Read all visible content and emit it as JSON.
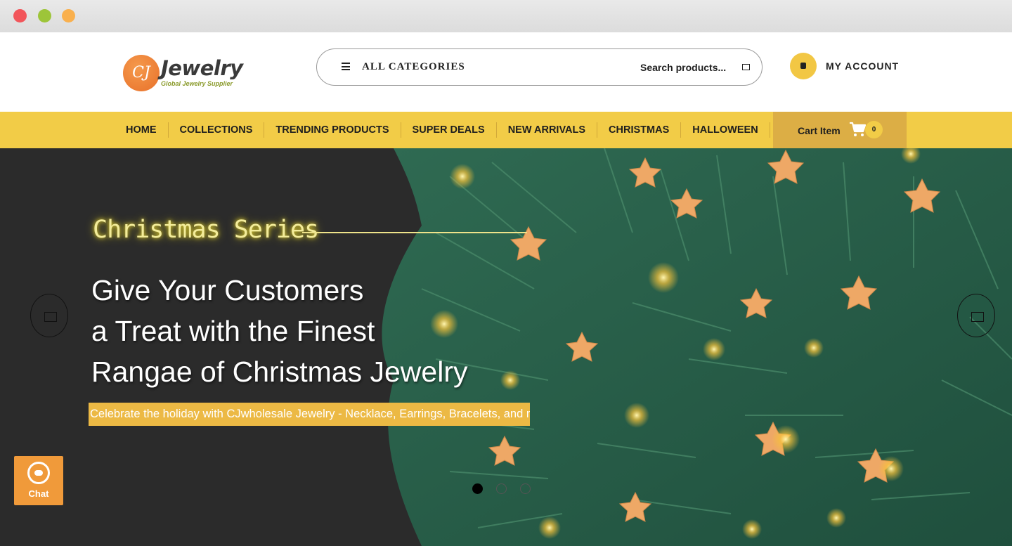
{
  "header": {
    "logo_monogram": "CJ",
    "logo_text": "Jewelry",
    "logo_tagline": "Global Jewelry Supplier",
    "categories_label": "ALL CATEGORIES",
    "search_placeholder": "Search products...",
    "account_label": "MY ACCOUNT"
  },
  "nav": {
    "items": [
      {
        "label": "HOME"
      },
      {
        "label": "COLLECTIONS"
      },
      {
        "label": "TRENDING PRODUCTS"
      },
      {
        "label": "SUPER DEALS"
      },
      {
        "label": "NEW ARRIVALS"
      },
      {
        "label": "CHRISTMAS"
      },
      {
        "label": "HALLOWEEN"
      }
    ],
    "cart_label": "Cart Item",
    "cart_count": "0"
  },
  "hero": {
    "series_title": "Christmas Series",
    "headline_1": "Give Your Customers",
    "headline_2": "a Treat with the Finest",
    "headline_3": "Rangae of Christmas Jewelry",
    "subline": "Celebrate the holiday with CJwholesale Jewelry - Necklace, Earrings, Bracelets, and more!",
    "slide_count": 3,
    "active_slide": 1
  },
  "chat": {
    "label": "Chat"
  },
  "colors": {
    "accent_yellow": "#f2cc47",
    "cart_bg": "#dcae45",
    "hero_bg": "#2b2b2b",
    "subline_bg": "#ecb944",
    "chat_bg": "#f09a3a",
    "logo_orange": "#e8702a"
  },
  "icons": [
    "menu-icon",
    "search-icon",
    "account-icon",
    "cart-icon",
    "prev-arrow-icon",
    "next-arrow-icon",
    "chat-headset-icon"
  ]
}
